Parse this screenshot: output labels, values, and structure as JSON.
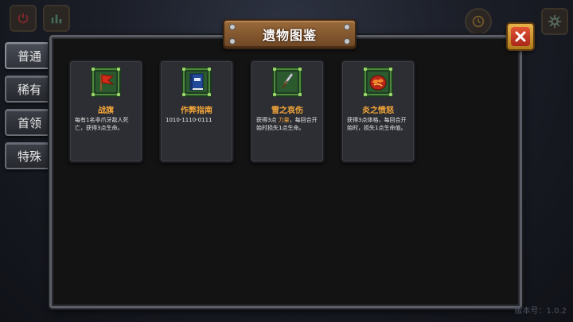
{
  "title": "遗物图鉴",
  "tabs": [
    {
      "label": "普通"
    },
    {
      "label": "稀有"
    },
    {
      "label": "首领"
    },
    {
      "label": "特殊"
    }
  ],
  "relics": [
    {
      "name": "战旗",
      "icon": "war-flag-icon",
      "desc": "每有1名非爪牙敌人死亡，获得3点生命。"
    },
    {
      "name": "作弊指南",
      "icon": "blue-book-icon",
      "desc": "1010-1110-0111"
    },
    {
      "name": "雪之哀伤",
      "icon": "dagger-icon",
      "desc_before": "获得3点 ",
      "desc_highlight": "力量",
      "desc_after": "，每回合开始时损失1点生命。"
    },
    {
      "name": "炎之愤怒",
      "icon": "fire-gem-icon",
      "desc": "获得3点体格，每回合开始时，损失1点生命值。"
    }
  ],
  "version": "版本号：1.0.2",
  "colors": {
    "accent_orange": "#f4a63a",
    "frame_green": "#4e8a3e",
    "close_red": "#c8341f"
  }
}
